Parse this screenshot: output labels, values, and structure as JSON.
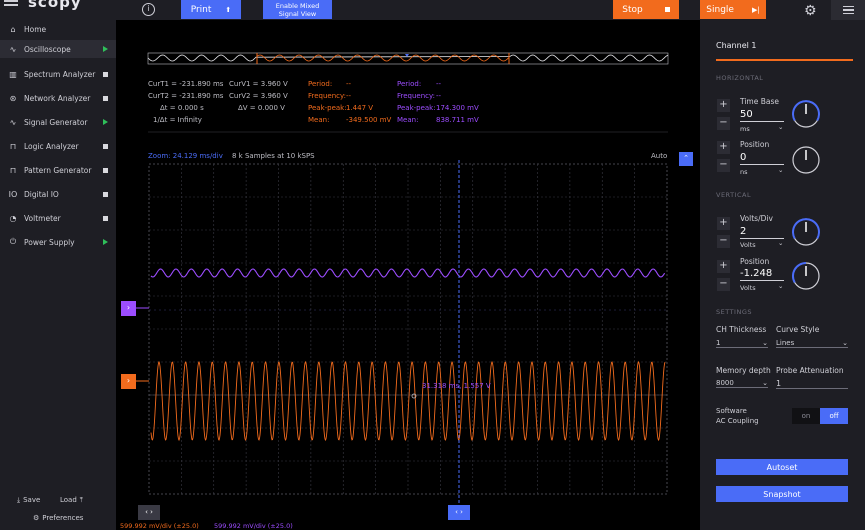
{
  "app": {
    "logo": "scopy"
  },
  "toolbar": {
    "info": "i",
    "print_label": "Print",
    "mixed_label_1": "Enable Mixed",
    "mixed_label_2": "Signal View",
    "stop_label": "Stop",
    "single_label": "Single",
    "gear": "⚙"
  },
  "sidebar": {
    "items": [
      {
        "icon": "⌂",
        "label": "Home",
        "status": "none"
      },
      {
        "icon": "∿",
        "label": "Oscilloscope",
        "status": "play"
      },
      {
        "icon": "▥",
        "label": "Spectrum Analyzer",
        "status": "square"
      },
      {
        "icon": "⊛",
        "label": "Network Analyzer",
        "status": "square"
      },
      {
        "icon": "∿",
        "label": "Signal Generator",
        "status": "play"
      },
      {
        "icon": "⊓",
        "label": "Logic Analyzer",
        "status": "square"
      },
      {
        "icon": "⊓",
        "label": "Pattern Generator",
        "status": "square"
      },
      {
        "icon": "IO",
        "label": "Digital IO",
        "status": "square"
      },
      {
        "icon": "◔",
        "label": "Voltmeter",
        "status": "square"
      },
      {
        "icon": "⏻",
        "label": "Power Supply",
        "status": "play"
      }
    ],
    "save_label": "Save",
    "load_label": "Load",
    "preferences_label": "Preferences"
  },
  "readouts": {
    "curt1": "CurT1 = -231.890 ms",
    "curt2": "CurT2 = -231.890 ms",
    "dt": "Δt = 0.000 s",
    "inv_dt": "1/Δt = Infinity",
    "curv1": "CurV1 = 3.960 V",
    "curv2": "CurV2 = 3.960 V",
    "dv": "ΔV = 0.000 V",
    "ch1": {
      "period": "Period:",
      "period_val": "--",
      "freq": "Frequency:",
      "freq_val": "--",
      "pp": "Peak-peak:",
      "pp_val": "1.447 V",
      "mean": "Mean:",
      "mean_val": "-349.500 mV"
    },
    "ch2": {
      "period": "Period:",
      "period_val": "--",
      "freq": "Frequency:",
      "freq_val": "--",
      "pp": "Peak-peak:",
      "pp_val": "174.300 mV",
      "mean": "Mean:",
      "mean_val": "838.711 mV"
    }
  },
  "plot": {
    "zoom": "Zoom: 24.129 ms/div",
    "samples": "8 k Samples at 10 kSPS",
    "trigger_mode": "Auto",
    "cursor_text": "31.318 ms, 1.557 V",
    "ch1_scale": "599.992 mV/div (±25.0)",
    "ch2_scale": "599.992 mV/div (±25.0)",
    "colors": {
      "ch1": "#f26b1d",
      "ch2": "#9c4dff",
      "grid": "#3a3a44",
      "cursor": "#4a6cf7"
    }
  },
  "panel": {
    "title": "Channel 1",
    "horizontal": "HORIZONTAL",
    "time_base_label": "Time Base",
    "time_base_value": "50",
    "time_base_unit": "ms",
    "h_position_label": "Position",
    "h_position_value": "0",
    "h_position_unit": "ns",
    "vertical": "VERTICAL",
    "volts_div_label": "Volts/Div",
    "volts_div_value": "2",
    "volts_div_unit": "Volts",
    "v_position_label": "Position",
    "v_position_value": "-1.248",
    "v_position_unit": "Volts",
    "settings": "SETTINGS",
    "thickness_label": "CH Thickness",
    "thickness_value": "1",
    "curve_style_label": "Curve Style",
    "curve_style_value": "Lines",
    "memory_label": "Memory depth",
    "memory_value": "8000",
    "probe_label": "Probe Attenuation",
    "probe_value": "1",
    "ac_label_1": "Software",
    "ac_label_2": "AC Coupling",
    "ac_on": "on",
    "ac_off": "off",
    "autoset_label": "Autoset",
    "snapshot_label": "Snapshot"
  }
}
